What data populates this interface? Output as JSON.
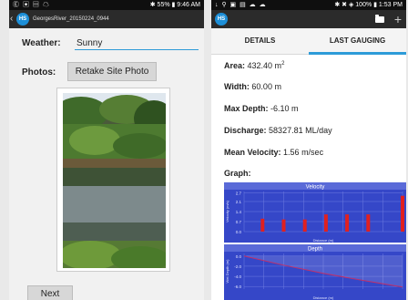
{
  "left": {
    "status": {
      "left": "Ⓔ ▣ ▤ ☁",
      "right": "✱ 55% ▮ 9:46 AM"
    },
    "actionbar": {
      "back": "‹",
      "app_icon": "HS",
      "title": "GeorgesRiver_20150224_0944"
    },
    "weather": {
      "label": "Weather:",
      "value": "Sunny"
    },
    "photos": {
      "label": "Photos:",
      "button": "Retake Site Photo"
    },
    "next_button": "Next"
  },
  "right": {
    "status": {
      "left": "↓ ⚲ ▣ ▤ ☁ ☁",
      "right": "✱ ✖ ◈ 100% ▮ 1:53 PM"
    },
    "actionbar": {
      "app_icon": "HS",
      "plus": "+"
    },
    "tabs": [
      {
        "label": "DETAILS",
        "active": false
      },
      {
        "label": "LAST GAUGING",
        "active": true
      }
    ],
    "area": {
      "label": "Area:",
      "value": "432.40 m",
      "unit_sup": "2"
    },
    "width": {
      "label": "Width:",
      "value": "60.00 m"
    },
    "max_depth": {
      "label": "Max Depth:",
      "value": "-6.10 m"
    },
    "discharge": {
      "label": "Discharge:",
      "value": "58327.81 ML/day"
    },
    "mean_velocity": {
      "label": "Mean Velocity:",
      "value": "1.56 m/sec"
    },
    "graph_label": "Graph:"
  },
  "chart_data": [
    {
      "type": "bar",
      "title": "Velocity",
      "ylabel": "Velocity (m/s)",
      "xlabel": "Distance (m)",
      "yticks": [
        "2.7",
        "2.1",
        "1.4",
        "0.7",
        "0.0"
      ],
      "ylim": [
        0,
        2.8
      ],
      "xlim": [
        0,
        60
      ],
      "x": [
        7,
        15,
        23,
        31,
        39,
        47,
        60
      ],
      "values": [
        0.9,
        0.85,
        0.85,
        1.2,
        1.2,
        1.2,
        2.5
      ],
      "color": "#e02020",
      "background": "#3547c8"
    },
    {
      "type": "area",
      "title": "Depth",
      "ylabel": "Wet Depth (m)",
      "xlabel": "Distance (m)",
      "yticks": [
        "0.0",
        "-2.0",
        "-4.0",
        "-6.0"
      ],
      "ylim": [
        -6.5,
        0.5
      ],
      "xlim": [
        0,
        60
      ],
      "x": [
        0,
        15,
        30,
        45,
        60
      ],
      "values": [
        0.0,
        -1.8,
        -3.4,
        -4.8,
        -6.1
      ],
      "color": "#e8e8f4",
      "line_color": "#c0306a",
      "background": "#3547c8"
    }
  ]
}
